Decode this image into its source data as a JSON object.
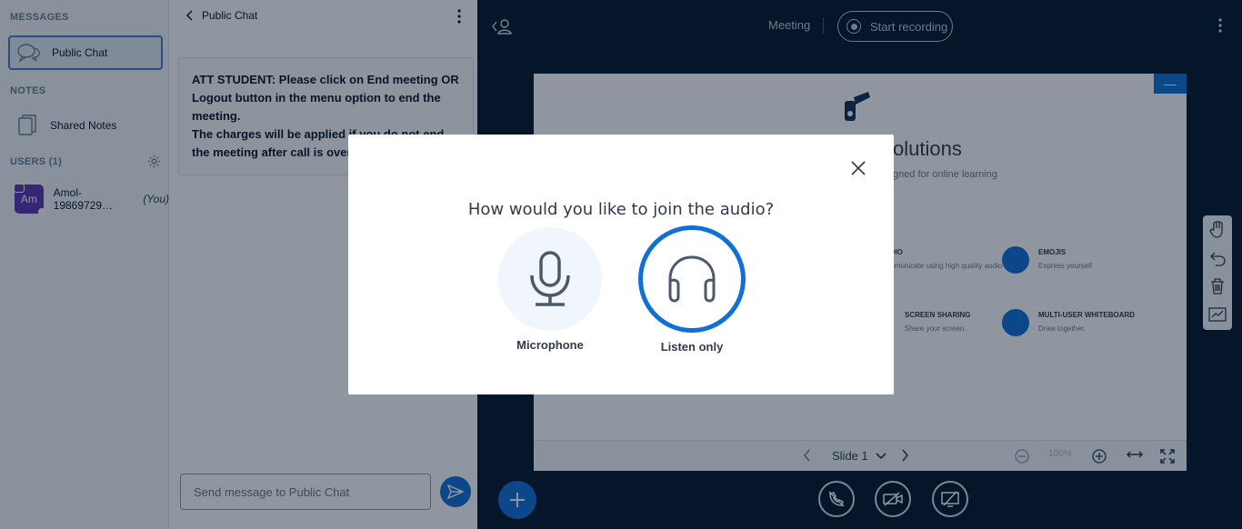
{
  "sidebar": {
    "messages_title": "MESSAGES",
    "public_chat_label": "Public Chat",
    "notes_title": "NOTES",
    "shared_notes_label": "Shared Notes",
    "users_title": "USERS (1)",
    "user": {
      "initials": "Am",
      "name": "Amol-19869729…",
      "you_tag": "(You)"
    }
  },
  "chat": {
    "title": "Public Chat",
    "welcome_prefix": "ATT STUDENT: Please click on ",
    "welcome_end_meeting": "End meeting",
    "welcome_or": " OR ",
    "welcome_logout": "Logout",
    "welcome_suffix": " button in the menu option to end the meeting.",
    "welcome_line2": "The charges will be applied if you do not end the meeting after call is over.",
    "input_placeholder": "Send message to Public Chat"
  },
  "main": {
    "meeting_title": "Meeting",
    "record_label": "Start recording",
    "slide": {
      "title_partial": "olutions",
      "subtitle_partial": "gned for online learning",
      "features": [
        {
          "title": "AUDIO",
          "desc": "Communicate using high quality audio"
        },
        {
          "title": "EMOJIS",
          "desc": "Express yourself"
        },
        {
          "title": "SCREEN SHARING",
          "desc": "Share your screen."
        },
        {
          "title": "MULTI-USER WHITEBOARD",
          "desc": "Draw together."
        }
      ],
      "slide_label": "Slide 1",
      "zoom_label": "100%"
    }
  },
  "modal": {
    "title": "How would you like to join the audio?",
    "microphone_label": "Microphone",
    "listen_only_label": "Listen only"
  },
  "colors": {
    "accent": "#0f70d7",
    "dark_bg": "#06172a",
    "panel_bg": "#f3f6f9"
  }
}
